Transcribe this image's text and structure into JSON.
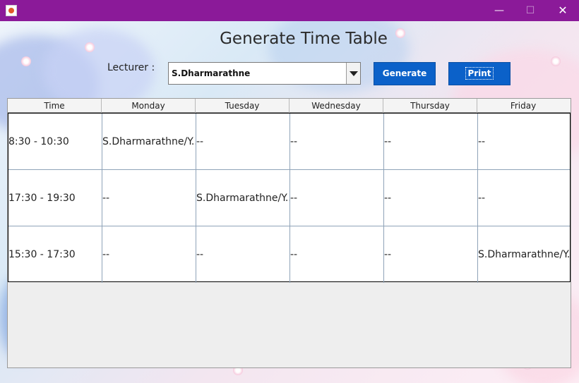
{
  "window": {
    "minimize_glyph": "—",
    "maximize_glyph": "☐",
    "close_glyph": "✕"
  },
  "heading": "Generate Time Table",
  "lecturer": {
    "label": "Lecturer :",
    "selected": "S.Dharmarathne"
  },
  "buttons": {
    "generate": "Generate",
    "print": "Print"
  },
  "table": {
    "columns": [
      "Time",
      "Monday",
      "Tuesday",
      "Wednesday",
      "Thursday",
      "Friday"
    ],
    "rows": [
      [
        "8:30 - 10:30",
        "S.Dharmarathne/Y...",
        "--",
        "--",
        "--",
        "--"
      ],
      [
        "17:30 - 19:30",
        "--",
        "S.Dharmarathne/Y...",
        "--",
        "--",
        "--"
      ],
      [
        "15:30 - 17:30",
        "--",
        "--",
        "--",
        "--",
        "S.Dharmarathne/Y..."
      ]
    ]
  },
  "colors": {
    "titlebar": "#8b1a99",
    "button": "#0b61c9"
  }
}
